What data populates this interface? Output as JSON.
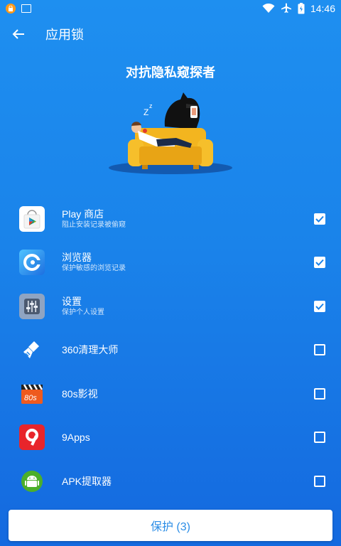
{
  "status": {
    "time": "14:46"
  },
  "header": {
    "title": "应用锁"
  },
  "hero": {
    "title": "对抗隐私窥探者"
  },
  "apps": [
    {
      "name": "Play 商店",
      "subtitle": "阻止安装记录被偷窥",
      "checked": true,
      "icon": "play-store-icon"
    },
    {
      "name": "浏览器",
      "subtitle": "保护敏感的浏览记录",
      "checked": true,
      "icon": "browser-icon"
    },
    {
      "name": "设置",
      "subtitle": "保护个人设置",
      "checked": true,
      "icon": "settings-icon"
    },
    {
      "name": "360清理大师",
      "subtitle": "",
      "checked": false,
      "icon": "cleaner-icon"
    },
    {
      "name": "80s影视",
      "subtitle": "",
      "checked": false,
      "icon": "movie-clapper-icon"
    },
    {
      "name": "9Apps",
      "subtitle": "",
      "checked": false,
      "icon": "9apps-icon"
    },
    {
      "name": "APK提取器",
      "subtitle": "",
      "checked": false,
      "icon": "android-icon"
    }
  ],
  "footer": {
    "protect_label": "保护 (3)"
  },
  "colors": {
    "background": "#1a83ea",
    "button_text": "#2b8de6"
  }
}
